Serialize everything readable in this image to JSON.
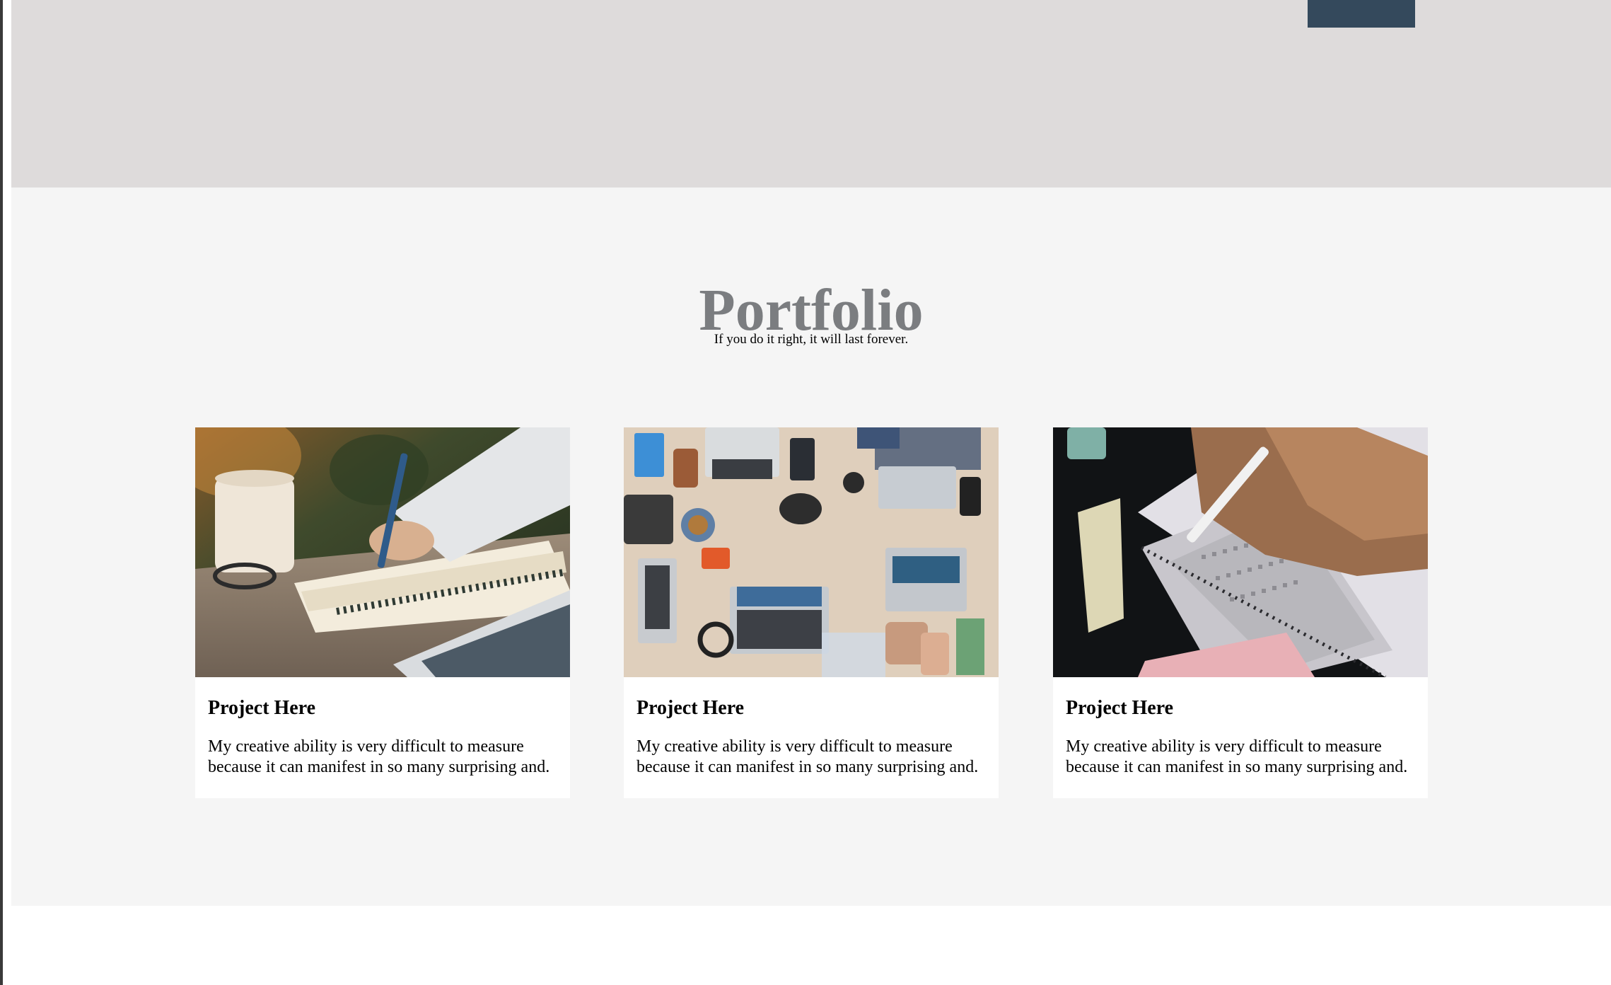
{
  "section": {
    "title": "Portfolio",
    "subtitle": "If you do it right, it will last forever."
  },
  "cards": [
    {
      "title": "Project Here",
      "text": "My creative ability is very difficult to measure because it can manifest in so many surprising and."
    },
    {
      "title": "Project Here",
      "text": "My creative ability is very difficult to measure because it can manifest in so many surprising and."
    },
    {
      "title": "Project Here",
      "text": "My creative ability is very difficult to measure because it can manifest in so many surprising and."
    }
  ],
  "colors": {
    "hero_background": "#dedbdb",
    "header_tab": "#34495c",
    "section_background": "#f5f5f5",
    "title_gray": "#7b7d80"
  }
}
